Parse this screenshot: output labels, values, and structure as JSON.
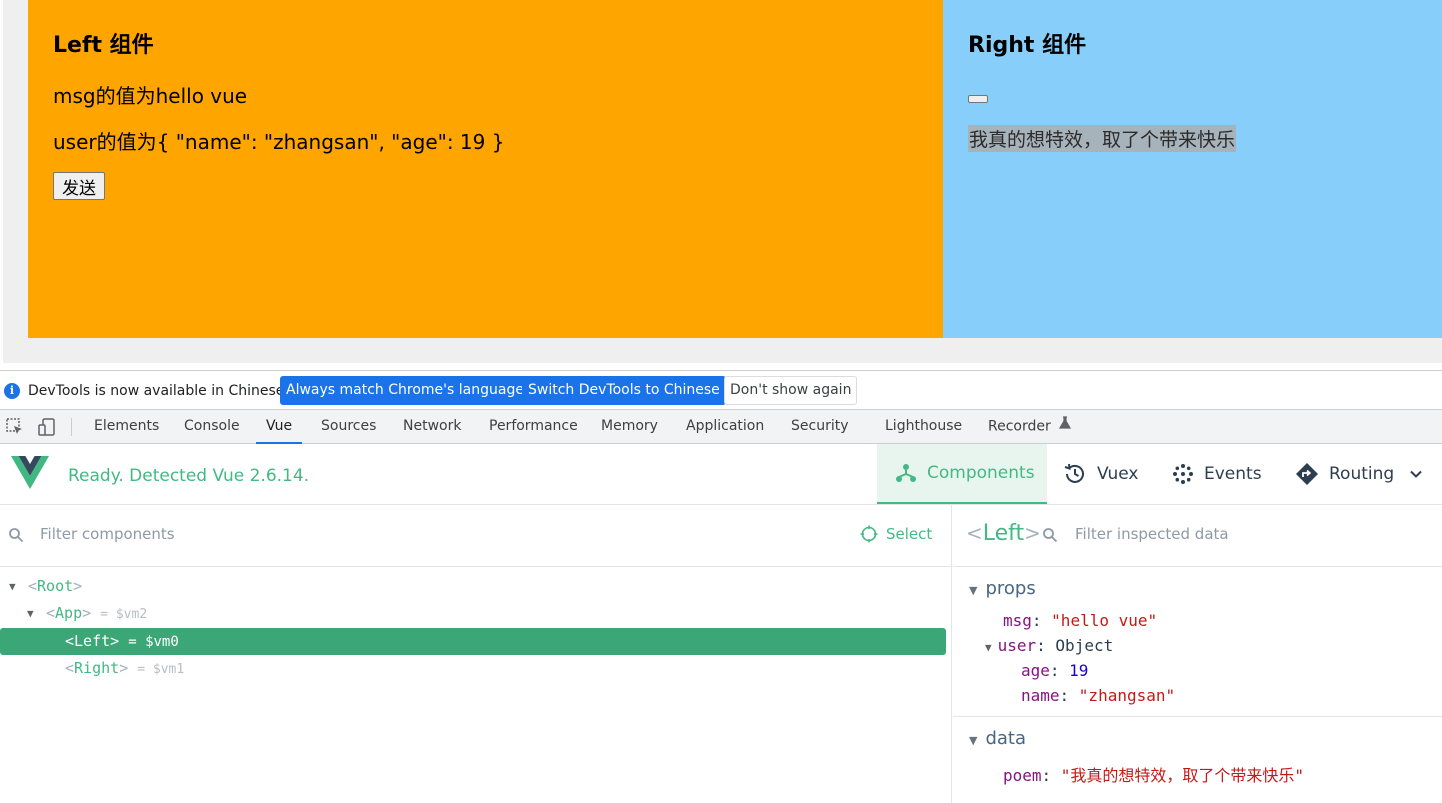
{
  "page": {
    "left": {
      "title": "Left 组件",
      "msg_line": "msg的值为hello vue",
      "user_line": "user的值为{ \"name\": \"zhangsan\", \"age\": 19 }",
      "send_label": "发送"
    },
    "right": {
      "title": "Right 组件",
      "poem_line": "我真的想特效，取了个带来快乐"
    }
  },
  "infobar": {
    "text": "DevTools is now available in Chinese!",
    "match_btn": "Always match Chrome's language",
    "switch_btn": "Switch DevTools to Chinese",
    "dont_btn": "Don't show again"
  },
  "tabs": {
    "elements": "Elements",
    "console": "Console",
    "vue": "Vue",
    "sources": "Sources",
    "network": "Network",
    "performance": "Performance",
    "memory": "Memory",
    "application": "Application",
    "security": "Security",
    "lighthouse": "Lighthouse",
    "recorder": "Recorder",
    "active": "Vue"
  },
  "vue": {
    "status": "Ready. Detected Vue 2.6.14.",
    "nav": {
      "components": "Components",
      "vuex": "Vuex",
      "events": "Events",
      "routing": "Routing"
    },
    "filter_placeholder": "Filter components",
    "select_label": "Select",
    "tree": [
      {
        "name": "Root",
        "ref": ""
      },
      {
        "name": "App",
        "ref": "= $vm2"
      },
      {
        "name": "Left",
        "ref": "= $vm0"
      },
      {
        "name": "Right",
        "ref": "= $vm1"
      }
    ],
    "selected": "Left",
    "inspect": {
      "component": "Left",
      "filter_placeholder": "Filter inspected data",
      "props_label": "props",
      "data_label": "data",
      "msg_key": "msg",
      "msg_val": "\"hello vue\"",
      "user_key": "user",
      "user_val": "Object",
      "age_key": "age",
      "age_val": "19",
      "name_key": "name",
      "name_val": "\"zhangsan\"",
      "poem_key": "poem",
      "poem_val": "\"我真的想特效，取了个带来快乐\""
    }
  },
  "colors": {
    "left_bg": "#ffa500",
    "right_bg": "#87cefa",
    "vue_green": "#42b983",
    "devtools_blue": "#1a73e8"
  }
}
